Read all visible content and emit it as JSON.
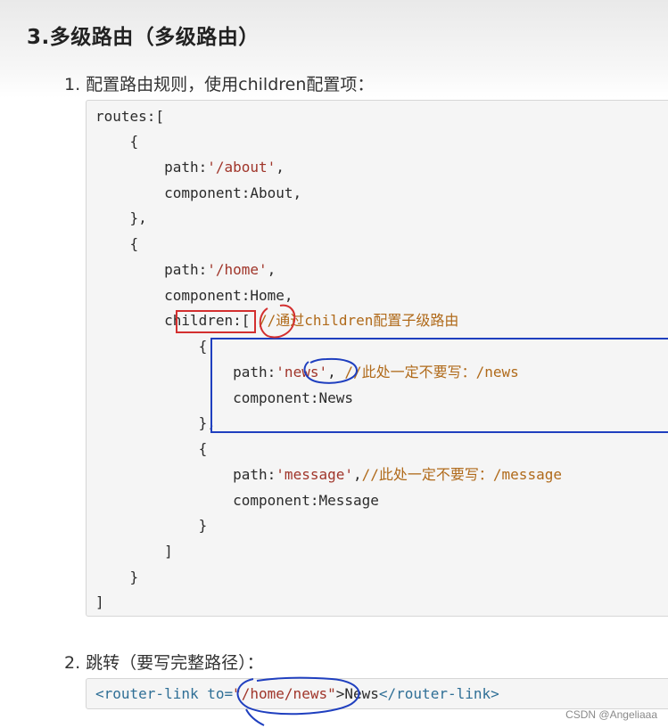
{
  "heading": "3.多级路由（多级路由）",
  "step1": "1. 配置路由规则，使用children配置项：",
  "step2": "2. 跳转（要写完整路径）：",
  "code": {
    "l1": "routes:[",
    "l2": "    {",
    "l3_key": "        path:",
    "l3_val": "'/about'",
    "l3_end": ",",
    "l4": "        component:About,",
    "l5": "    },",
    "l6": "    {",
    "l7_key": "        path:",
    "l7_val": "'/home'",
    "l7_end": ",",
    "l8": "        component:Home,",
    "l9_key": "        children",
    "l9_mid": ":[ ",
    "l9_cmt": "//通过children配置子级路由",
    "l10": "            {",
    "l11_key": "                path:",
    "l11_val": "'news'",
    "l11_mid": ", ",
    "l11_cmt": "//此处一定不要写：/news",
    "l12": "                component:News",
    "l13": "            },",
    "l14": "            {",
    "l15_key": "                path:",
    "l15_val": "'message'",
    "l15_mid": ",",
    "l15_cmt": "//此处一定不要写：/message",
    "l16": "                component:Message",
    "l17": "            }",
    "l18": "        ]",
    "l19": "    }",
    "l20": "]"
  },
  "link_code": {
    "open_tag": "<router-link to=",
    "attr_val": "\"/home/news\"",
    "text": ">News",
    "close_tag": "</router-link>"
  },
  "watermark": "CSDN @Angeliaaa",
  "colors": {
    "annotation_red": "#d32f2f",
    "annotation_blue": "#1f3fbf"
  }
}
